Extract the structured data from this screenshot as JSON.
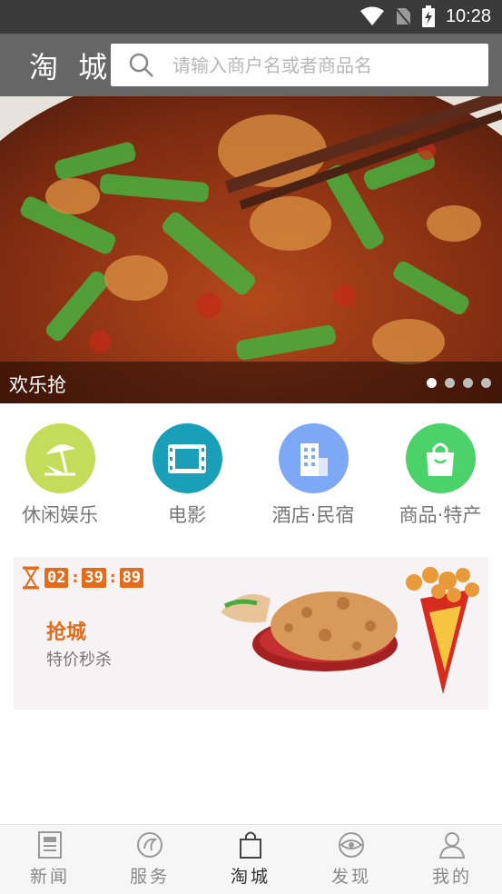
{
  "status_bar": {
    "time": "10:28"
  },
  "header": {
    "title": "淘 城",
    "search_placeholder": "请输入商户名或者商品名"
  },
  "banner": {
    "caption": "欢乐抢",
    "dot_count": 4,
    "active_dot": 0
  },
  "categories": [
    {
      "label": "休闲娱乐",
      "icon": "beach-umbrella-icon",
      "color": "#c5dc5a"
    },
    {
      "label": "电影",
      "icon": "film-strip-icon",
      "color": "#1a9fb8"
    },
    {
      "label": "酒店·民宿",
      "icon": "building-icon",
      "color": "#7da8f5"
    },
    {
      "label": "商品·特产",
      "icon": "shopping-bag-icon",
      "color": "#4bd36a"
    }
  ],
  "promo": {
    "countdown": [
      "02",
      "39",
      "89"
    ],
    "title": "抢城",
    "subtitle": "特价秒杀"
  },
  "tabs": [
    {
      "label": "新闻",
      "icon": "newspaper-icon"
    },
    {
      "label": "服务",
      "icon": "service-icon"
    },
    {
      "label": "淘城",
      "icon": "shopping-bag-icon"
    },
    {
      "label": "发现",
      "icon": "eye-icon"
    },
    {
      "label": "我的",
      "icon": "person-icon"
    }
  ],
  "active_tab": 2
}
